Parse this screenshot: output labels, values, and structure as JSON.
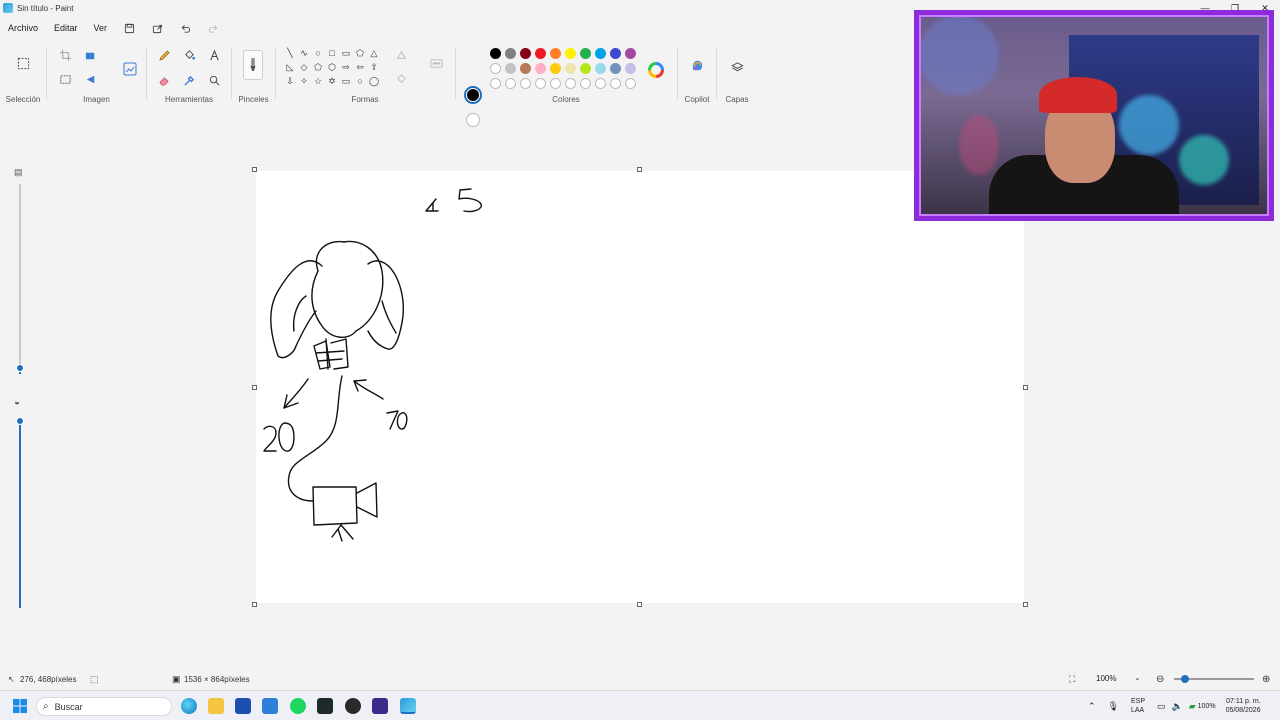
{
  "window": {
    "title": "Sin título - Paint"
  },
  "menu": {
    "file": "Archivo",
    "edit": "Editar",
    "view": "Ver"
  },
  "ribbon": {
    "groups": {
      "selection": "Selección",
      "image": "Imagen",
      "tools": "Herramientas",
      "brushes": "Pinceles",
      "shapes": "Formas",
      "colors": "Colores",
      "copilot": "Copilot",
      "layers": "Capas"
    },
    "palette_row1": [
      "#000000",
      "#7f7f7f",
      "#880015",
      "#ed1c24",
      "#ff7f27",
      "#fff200",
      "#22b14c",
      "#00a2e8",
      "#3f48cc",
      "#a349a4"
    ],
    "palette_row2": [
      "#ffffff",
      "#c3c3c3",
      "#b97a57",
      "#ffaec9",
      "#ffc90e",
      "#efe4b0",
      "#b5e61d",
      "#99d9ea",
      "#7092be",
      "#c8bfe7"
    ],
    "primary_color": "#000000",
    "secondary_color": "#ffffff"
  },
  "canvas": {
    "labels": {
      "top": "4 5",
      "left": "20",
      "right": "70"
    }
  },
  "status": {
    "cursor": "276, 468píxeles",
    "size": "1536 × 864píxeles",
    "zoom": "100%"
  },
  "taskbar": {
    "search_placeholder": "Buscar",
    "lang_top": "ESP",
    "lang_bottom": "LAA",
    "battery": "100%",
    "time": "07:11 p. m.",
    "date": "05/08/2026"
  }
}
